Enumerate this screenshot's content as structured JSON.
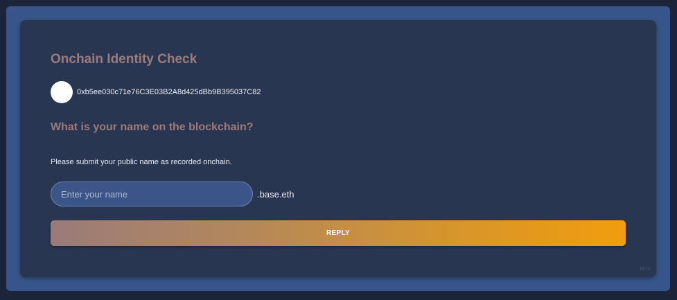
{
  "card": {
    "title": "Onchain Identity Check",
    "address": "0xb5ee030c71e76C3E03B2A8d425dBb9B395037C82",
    "question": "What is your name on the blockchain?",
    "instructions": "Please submit your public name as recorded onchain.",
    "name_input": {
      "value": "",
      "placeholder": "Enter your name"
    },
    "name_suffix": ".base.eth",
    "reply_label": "REPLY",
    "beta_label": "BETA"
  },
  "colors": {
    "page_background": "#1b2438",
    "frame": "#37558a",
    "card": "#283651",
    "heading": "#9b7b7b",
    "button_gradient_start": "#9a7b7a",
    "button_gradient_end": "#f29d0e"
  }
}
